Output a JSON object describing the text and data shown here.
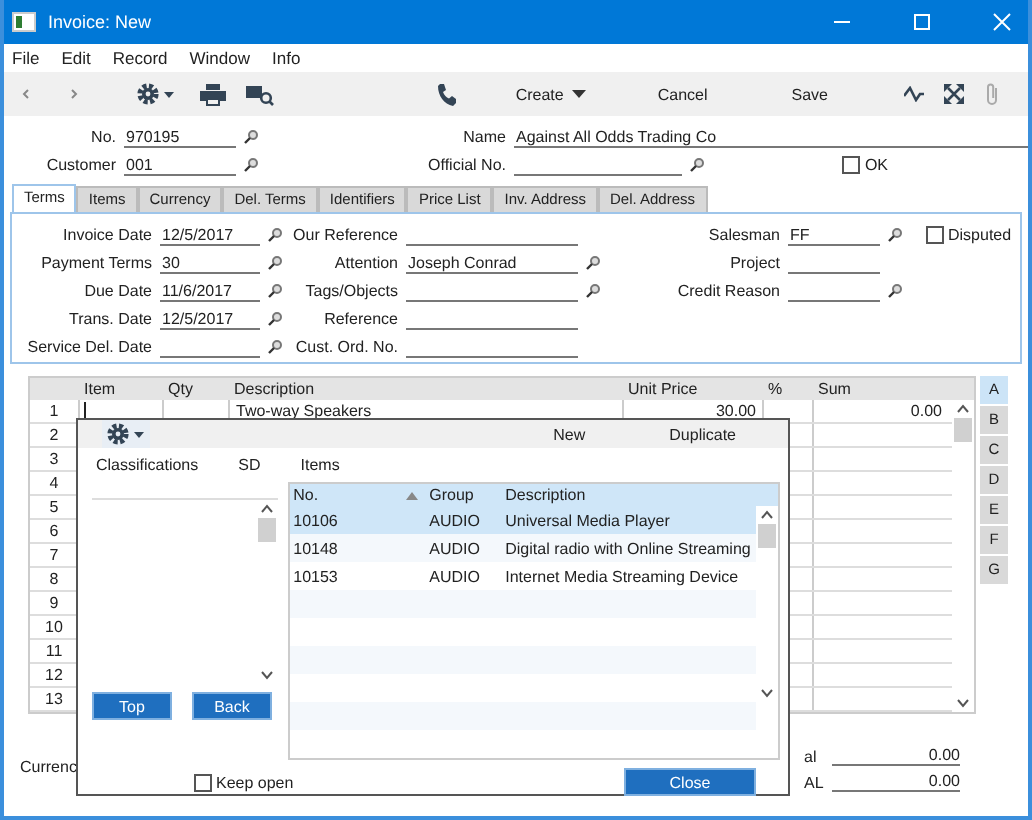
{
  "window": {
    "title": "Invoice: New"
  },
  "menu": [
    "File",
    "Edit",
    "Record",
    "Window",
    "Info"
  ],
  "toolbar": {
    "create": "Create",
    "cancel": "Cancel",
    "save": "Save"
  },
  "header": {
    "fields": [
      {
        "label": "No.",
        "value": "970195",
        "lookup": true
      },
      {
        "label": "Name",
        "value": "Against All Odds Trading Co",
        "lookup": false
      },
      {
        "label": "Customer",
        "value": "001",
        "lookup": true
      },
      {
        "label": "Official No.",
        "lookup": true
      }
    ],
    "ok": {
      "label": "OK",
      "checked": false
    }
  },
  "tabs": [
    {
      "label": "Terms",
      "selected": true
    },
    {
      "label": "Items",
      "selected": false
    },
    {
      "label": "Currency",
      "selected": false
    },
    {
      "label": "Del. Terms",
      "selected": false
    },
    {
      "label": "Identifiers",
      "selected": false
    },
    {
      "label": "Price List",
      "selected": false
    },
    {
      "label": "Inv. Address",
      "selected": false
    },
    {
      "label": "Del. Address",
      "selected": false
    }
  ],
  "terms": {
    "columns": [
      [
        {
          "label": "Invoice Date",
          "value": "12/5/2017",
          "lookup": true
        },
        {
          "label": "Payment Terms",
          "value": "30",
          "lookup": true
        },
        {
          "label": "Due Date",
          "value": "11/6/2017",
          "lookup": true
        },
        {
          "label": "Trans. Date",
          "value": "12/5/2017",
          "lookup": true
        },
        {
          "label": "Service Del. Date",
          "lookup": true
        }
      ],
      [
        {
          "label": "Our Reference",
          "lookup": false
        },
        {
          "label": "Attention",
          "value": "Joseph Conrad",
          "lookup": true
        },
        {
          "label": "Tags/Objects",
          "lookup": true
        },
        {
          "label": "Reference",
          "lookup": false
        },
        {
          "label": "Cust. Ord. No.",
          "lookup": false
        }
      ],
      [
        {
          "label": "Salesman",
          "value": "FF",
          "lookup": true
        },
        {
          "label": "Project",
          "lookup": false
        },
        {
          "label": "Credit Reason",
          "lookup": true
        }
      ]
    ],
    "disputed": {
      "label": "Disputed",
      "checked": false
    }
  },
  "grid": {
    "columns": [
      "Item",
      "Qty",
      "Description",
      "Unit Price",
      "%",
      "Sum"
    ],
    "rows": [
      {
        "number": "1",
        "item": "",
        "qty": "",
        "description": "Two-way Speakers",
        "unit_price": "30.00",
        "percent": "",
        "sum": "0.00"
      },
      {
        "number": "2"
      },
      {
        "number": "3"
      },
      {
        "number": "4"
      },
      {
        "number": "5"
      },
      {
        "number": "6"
      },
      {
        "number": "7"
      },
      {
        "number": "8"
      },
      {
        "number": "9"
      },
      {
        "number": "10"
      },
      {
        "number": "11"
      },
      {
        "number": "12"
      },
      {
        "number": "13"
      }
    ],
    "sections": [
      {
        "label": "A",
        "selected": true
      },
      {
        "label": "B",
        "selected": false
      },
      {
        "label": "C",
        "selected": false
      },
      {
        "label": "D",
        "selected": false
      },
      {
        "label": "E",
        "selected": false
      },
      {
        "label": "F",
        "selected": false
      },
      {
        "label": "G",
        "selected": false
      }
    ]
  },
  "footer": {
    "currency_label": "Currenc",
    "totals": [
      {
        "label": "al",
        "value": "0.00"
      },
      {
        "label": "AL",
        "value": "0.00"
      }
    ]
  },
  "popup": {
    "new": "New",
    "duplicate": "Duplicate",
    "tabs": [
      "Classifications",
      "SD",
      "Items"
    ],
    "columns": [
      "No.",
      "Group",
      "Description"
    ],
    "rows": [
      {
        "no": "10106",
        "group": "AUDIO",
        "description": "Universal Media Player",
        "selected": true
      },
      {
        "no": "10148",
        "group": "AUDIO",
        "description": "Digital radio with Online Streaming",
        "selected": false
      },
      {
        "no": "10153",
        "group": "AUDIO",
        "description": "Internet Media Streaming Device",
        "selected": false
      }
    ],
    "top": "Top",
    "back": "Back",
    "keep_open": {
      "label": "Keep open",
      "checked": false
    },
    "close": "Close"
  }
}
